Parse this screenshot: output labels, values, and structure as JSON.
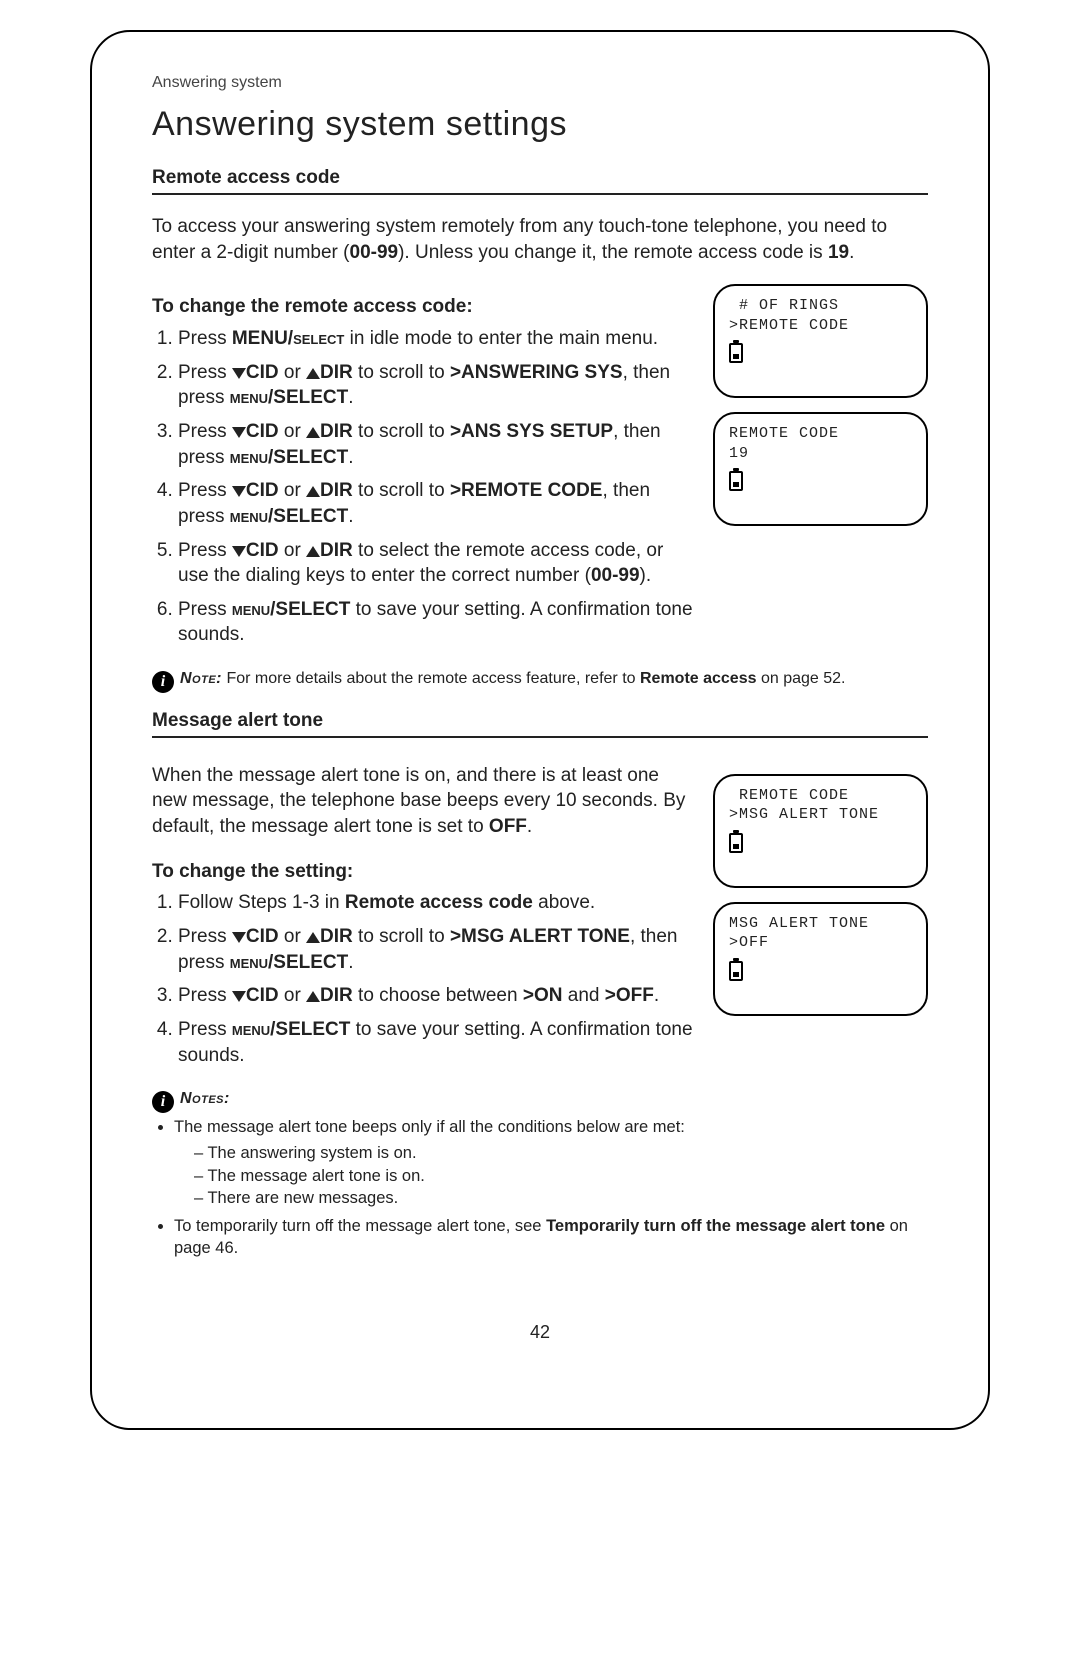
{
  "breadcrumb": "Answering system",
  "title": "Answering system settings",
  "pageNumber": "42",
  "icons": {
    "info": "i"
  },
  "nav": {
    "cid": "CID",
    "dir": "DIR"
  },
  "section1": {
    "head": "Remote access code",
    "intro_a": "To access your answering system remotely from any touch-tone telephone, you need to enter a 2-digit number (",
    "intro_range": "00-99",
    "intro_b": "). Unless you change it, the remote access code is ",
    "default_code": "19",
    "intro_c": ".",
    "subhead": "To change the remote access code:",
    "step1_a": "Press ",
    "step1_key": "MENU/",
    "step1_keysc": "select",
    "step1_b": " in idle mode to enter the main menu.",
    "step2_a": "Press ",
    "step2_b": " or ",
    "step2_c": " to scroll to ",
    "step2_target": ">ANSWERING SYS",
    "step2_d": ", then press ",
    "step2_key": "menu/SELECT",
    "step2_e": ".",
    "step3_a": "Press ",
    "step3_b": " or ",
    "step3_c": " to scroll to ",
    "step3_target": ">ANS SYS SETUP",
    "step3_d": ", then press ",
    "step3_key": "menu/SELECT",
    "step3_e": ".",
    "step4_a": "Press ",
    "step4_b": " or ",
    "step4_c": " to scroll to ",
    "step4_target": ">REMOTE CODE",
    "step4_d": ", then press ",
    "step4_key": "menu/SELECT",
    "step4_e": ".",
    "step5_a": "Press ",
    "step5_b": " or ",
    "step5_c": " to select the remote access code, or use the dialing keys to enter the correct number (",
    "step5_range": "00-99",
    "step5_d": ").",
    "step6_a": "Press ",
    "step6_key": "menu/SELECT",
    "step6_b": " to save your setting. A confirmation tone sounds.",
    "note_label": "Note:",
    "note_a": " For more details about the remote access feature, refer to ",
    "note_ref": "Remote access",
    "note_b": " on page 52."
  },
  "section2": {
    "head": "Message alert tone",
    "intro_a": "When the message alert tone is on, and there is at least one new message, the telephone base beeps every 10 seconds. By default, the message alert tone is set to ",
    "default": "OFF",
    "intro_b": ".",
    "subhead": "To change the setting:",
    "step1_a": "Follow Steps 1-3 in ",
    "step1_ref": "Remote access code",
    "step1_b": " above.",
    "step2_a": "Press ",
    "step2_b": " or ",
    "step2_c": " to scroll to ",
    "step2_target": ">MSG ALERT TONE",
    "step2_d": ", then press ",
    "step2_key": "menu/SELECT",
    "step2_e": ".",
    "step3_a": "Press ",
    "step3_b": " or ",
    "step3_c": " to choose between ",
    "step3_on": ">ON",
    "step3_and": " and ",
    "step3_off": ">OFF",
    "step3_d": ".",
    "step4_a": "Press ",
    "step4_key": "menu/SELECT",
    "step4_b": " to save your setting. A confirmation tone sounds.",
    "notes_label": "Notes:",
    "bullet1": "The message alert tone beeps only if all the conditions below are met:",
    "dash1": "The answering system is on.",
    "dash2": "The message alert tone is on.",
    "dash3": "There are new messages.",
    "bullet2_a": "To temporarily turn off the message alert tone, see ",
    "bullet2_ref": "Temporarily turn off the message alert tone",
    "bullet2_b": " on page 46."
  },
  "screens": {
    "s1_l1": " # OF RINGS",
    "s1_l2": ">REMOTE CODE",
    "s2_l1": "REMOTE CODE",
    "s2_l2": "19",
    "s3_l1": " REMOTE CODE",
    "s3_l2": ">MSG ALERT TONE",
    "s4_l1": "MSG ALERT TONE",
    "s4_l2": ">OFF"
  }
}
